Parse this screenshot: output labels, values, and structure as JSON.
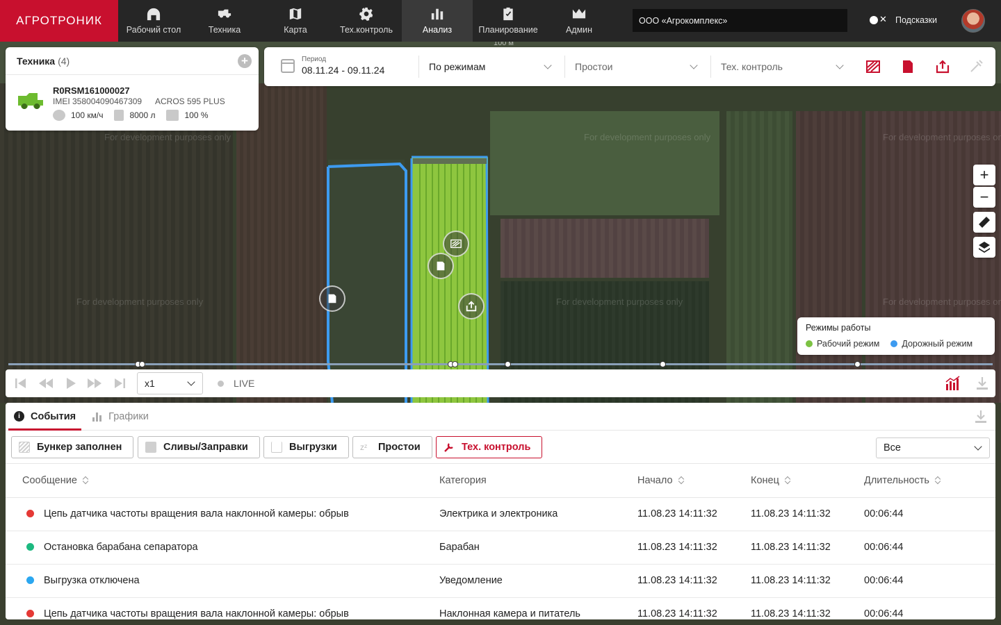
{
  "app": {
    "logo": "АГРОТРОНИК"
  },
  "nav": [
    {
      "label": "Рабочий стол",
      "icon": "home-icon"
    },
    {
      "label": "Техника",
      "icon": "combine-icon"
    },
    {
      "label": "Карта",
      "icon": "map-icon"
    },
    {
      "label": "Тех.контроль",
      "icon": "gear-icon"
    },
    {
      "label": "Анализ",
      "icon": "chart-icon",
      "active": true
    },
    {
      "label": "Планирование",
      "icon": "clipboard-icon"
    },
    {
      "label": "Админ",
      "icon": "crown-icon"
    }
  ],
  "header": {
    "organization": "ООО «Агрокомплекс»",
    "hints_label": "Подсказки",
    "hints_enabled": false
  },
  "tech": {
    "title": "Техника",
    "count": "(4)",
    "unit": {
      "name": "R0RSM161000027",
      "imei": "IMEI 358004090467309",
      "model": "ACROS 595 PLUS",
      "speed": "100 км/ч",
      "fuel": "8000 л",
      "load": "100 %"
    }
  },
  "filters": {
    "period_label": "Период",
    "period_value": "08.11.24 - 09.11.24",
    "mode": "По режимам",
    "idle": "Простои",
    "tech_control": "Тех. контроль"
  },
  "legend": {
    "title": "Режимы работы",
    "items": [
      {
        "label": "Рабочий режим",
        "color": "#7cc243"
      },
      {
        "label": "Дорожный режим",
        "color": "#3d9bf0"
      }
    ]
  },
  "map": {
    "watermark": "For development purposes only",
    "scale": "100 м"
  },
  "playback": {
    "speed": "x1",
    "live": "LIVE"
  },
  "panel": {
    "tabs": [
      {
        "label": "События",
        "active": true
      },
      {
        "label": "Графики",
        "active": false
      }
    ],
    "chips": [
      {
        "label": "Бункер заполнен"
      },
      {
        "label": "Сливы/Заправки"
      },
      {
        "label": "Выгрузки"
      },
      {
        "label": "Простои"
      },
      {
        "label": "Тех. контроль",
        "active": true
      }
    ],
    "filter_all": "Все",
    "columns": [
      "Сообщение",
      "Категория",
      "Начало",
      "Конец",
      "Длительность"
    ],
    "rows": [
      {
        "color": "#e53935",
        "message": "Цепь датчика частоты вращения вала наклонной камеры: обрыв",
        "category": "Электрика и электроника",
        "start": "11.08.23 14:11:32",
        "end": "11.08.23 14:11:32",
        "duration": "00:06:44"
      },
      {
        "color": "#1db980",
        "message": "Остановка барабана сепаратора",
        "category": "Барабан",
        "start": "11.08.23 14:11:32",
        "end": "11.08.23 14:11:32",
        "duration": "00:06:44"
      },
      {
        "color": "#2ba7f0",
        "message": "Выгрузка отключена",
        "category": "Уведомление",
        "start": "11.08.23 14:11:32",
        "end": "11.08.23 14:11:32",
        "duration": "00:06:44"
      },
      {
        "color": "#e53935",
        "message": "Цепь датчика частоты вращения вала наклонной камеры: обрыв",
        "category": "Наклонная камера и питатель",
        "start": "11.08.23 14:11:32",
        "end": "11.08.23 14:11:32",
        "duration": "00:06:44"
      }
    ]
  },
  "colors": {
    "brand": "#c8102e",
    "topbar": "#262626"
  }
}
